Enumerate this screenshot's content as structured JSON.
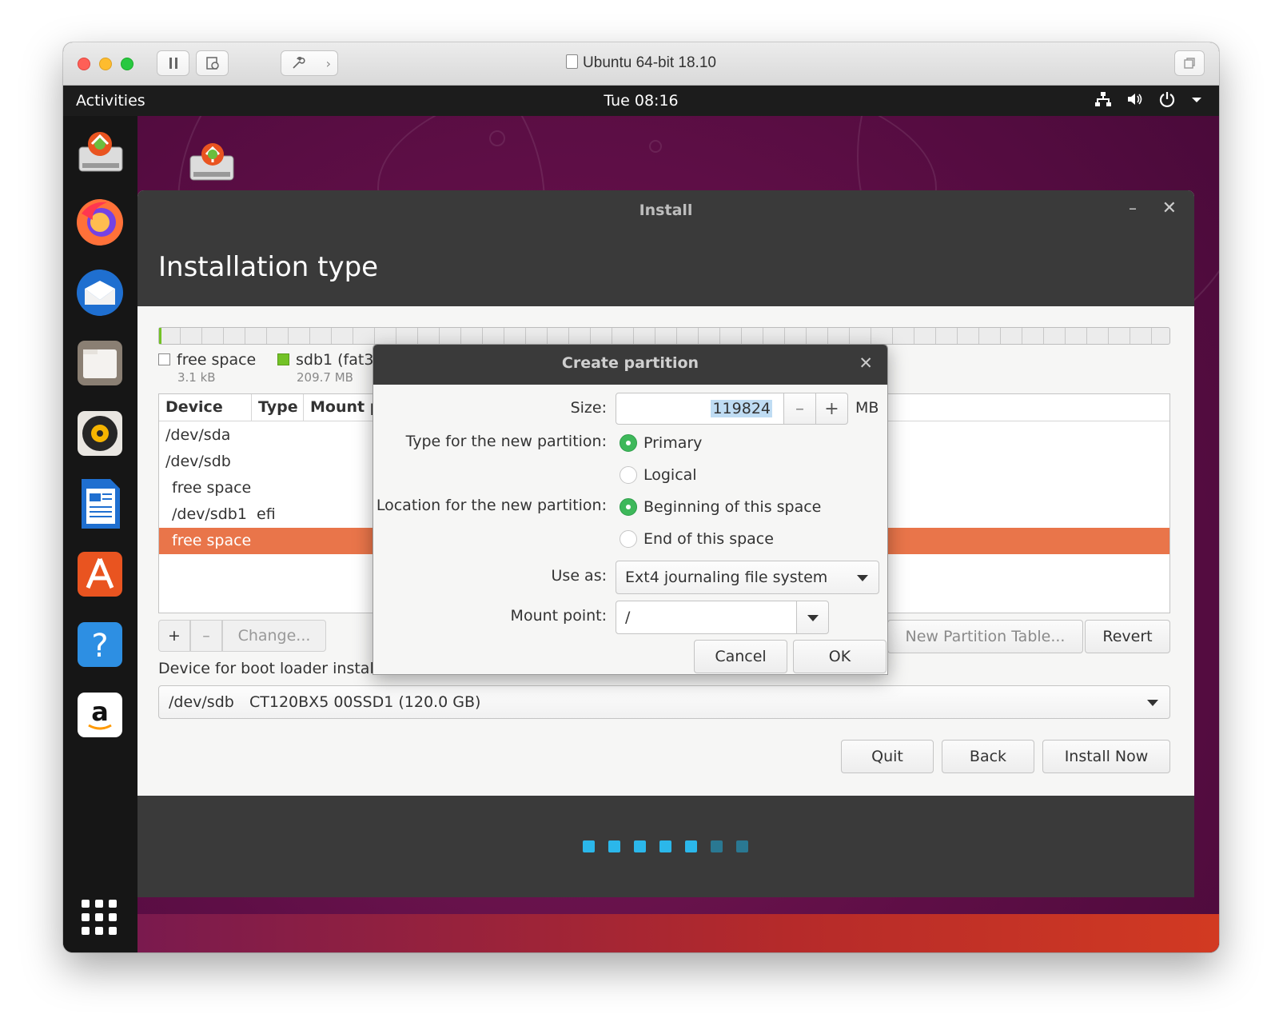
{
  "vm": {
    "title": "Ubuntu 64-bit 18.10"
  },
  "gnome": {
    "activities": "Activities",
    "clock": "Tue 08:16"
  },
  "dock": {
    "items": [
      "installer-icon",
      "firefox-icon",
      "thunderbird-icon",
      "files-icon",
      "rhythmbox-icon",
      "libreoffice-writer-icon",
      "software-center-icon",
      "help-icon",
      "amazon-icon"
    ],
    "help_glyph": "?",
    "amazon_glyph": "a"
  },
  "install": {
    "window_title": "Install",
    "heading": "Installation type",
    "legend": [
      {
        "label": "free space",
        "size": "3.1 kB",
        "color": "#ffffff"
      },
      {
        "label": "sdb1 (fat3",
        "size": "209.7 MB",
        "color": "#73c226"
      }
    ],
    "table": {
      "headers": [
        "Device",
        "Type",
        "Mount p"
      ],
      "rows": [
        {
          "device": "/dev/sda",
          "type": ""
        },
        {
          "device": "/dev/sdb",
          "type": ""
        },
        {
          "device": " free space",
          "type": ""
        },
        {
          "device": " /dev/sdb1",
          "type": "efi"
        },
        {
          "device": " free space",
          "type": "",
          "selected": true
        }
      ]
    },
    "tools": {
      "add": "+",
      "remove": "–",
      "change": "Change...",
      "new_table": "New Partition Table...",
      "revert": "Revert"
    },
    "boot_loader_label": "Device for boot loader instal",
    "boot_device": {
      "device": "/dev/sdb",
      "model": "CT120BX5 00SSD1 (120.0 GB)"
    },
    "buttons": {
      "quit": "Quit",
      "back": "Back",
      "install_now": "Install Now"
    },
    "progress": {
      "total": 7,
      "done": 5
    },
    "colors": {
      "selected_row": "#e9754a",
      "progress_done": "#2bb7ea",
      "progress_pending": "#2a7892"
    }
  },
  "dialog": {
    "title": "Create partition",
    "size_label": "Size:",
    "size_value": "119824",
    "size_unit": "MB",
    "type_label": "Type for the new partition:",
    "type_options": [
      "Primary",
      "Logical"
    ],
    "type_selected": "Primary",
    "location_label": "Location for the new partition:",
    "location_options": [
      "Beginning of this space",
      "End of this space"
    ],
    "location_selected": "Beginning of this space",
    "use_as_label": "Use as:",
    "use_as_value": "Ext4 journaling file system",
    "mount_label": "Mount point:",
    "mount_value": "/",
    "cancel": "Cancel",
    "ok": "OK"
  }
}
